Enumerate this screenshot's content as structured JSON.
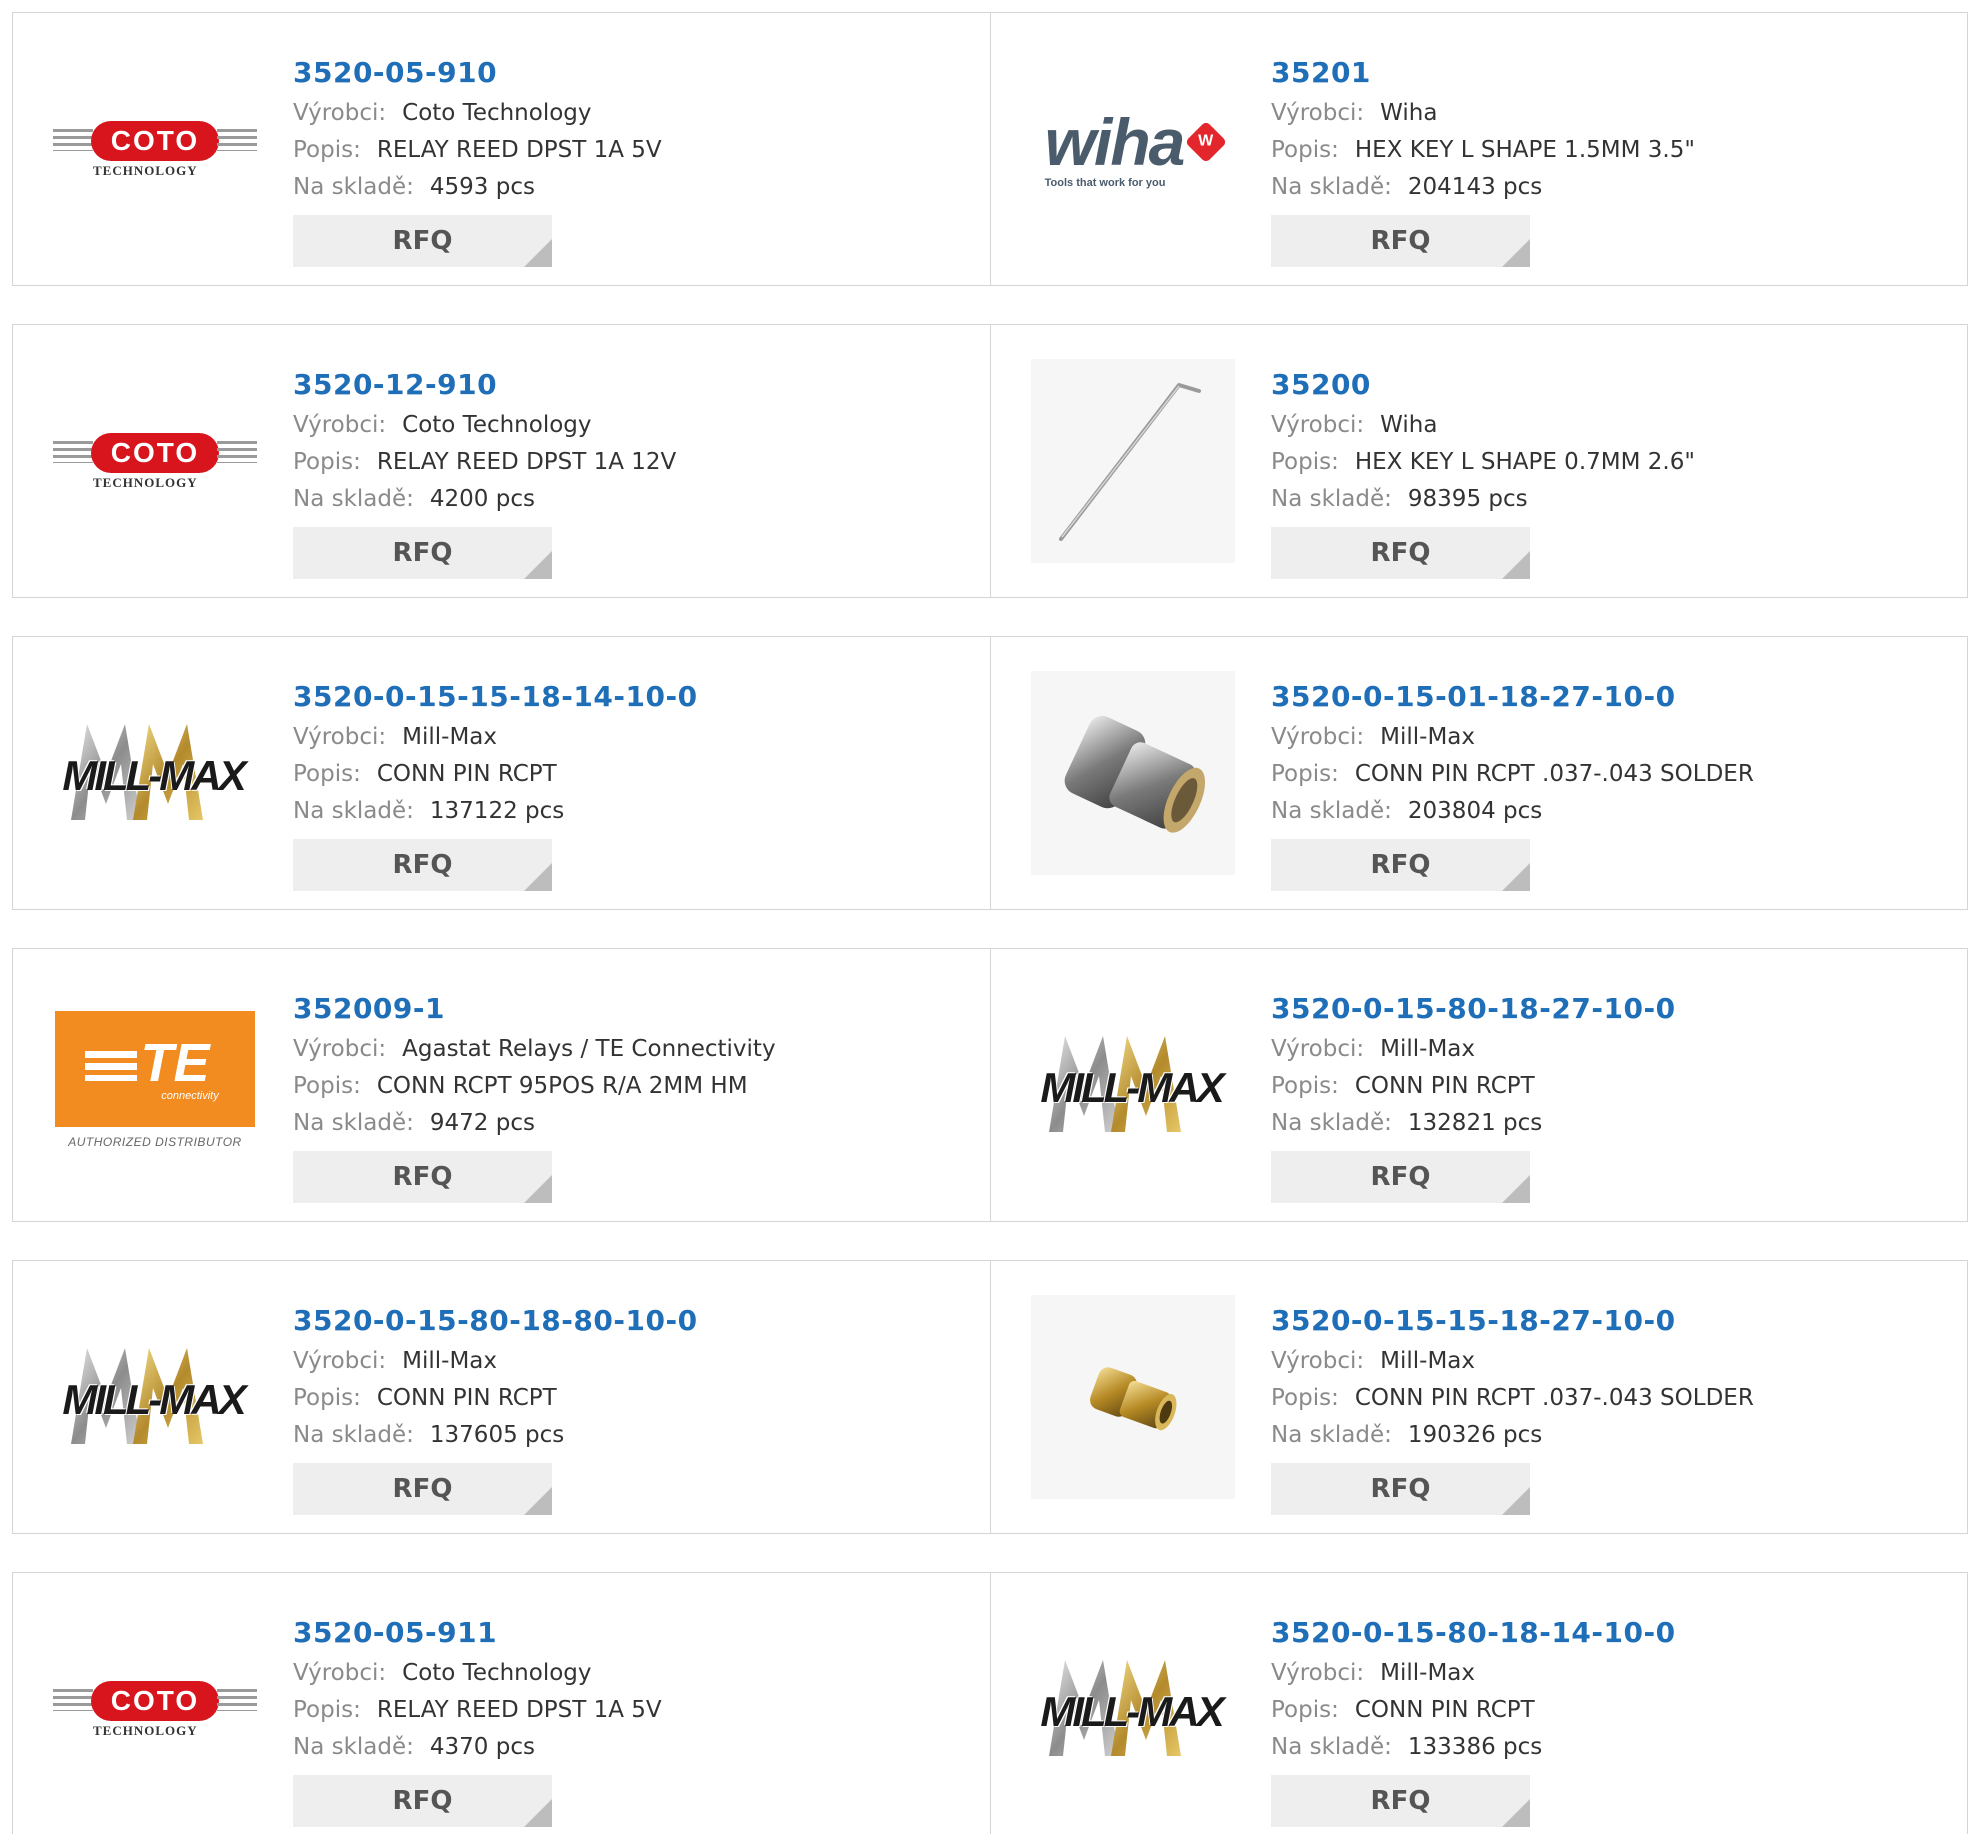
{
  "labels": {
    "manufacturer": "Výrobci:",
    "description": "Popis:",
    "stock": "Na skladě:",
    "rfq": "RFQ"
  },
  "rows": [
    {
      "left": {
        "part": "3520-05-910",
        "manufacturer": "Coto Technology",
        "description": "RELAY REED DPST 1A 5V",
        "stock": "4593 pcs",
        "logo": "coto-logo"
      },
      "right": {
        "part": "35201",
        "manufacturer": "Wiha",
        "description": "HEX KEY L SHAPE 1.5MM 3.5\"",
        "stock": "204143 pcs",
        "logo": "wiha-logo"
      }
    },
    {
      "left": {
        "part": "3520-12-910",
        "manufacturer": "Coto Technology",
        "description": "RELAY REED DPST 1A 12V",
        "stock": "4200 pcs",
        "logo": "coto-logo"
      },
      "right": {
        "part": "35200",
        "manufacturer": "Wiha",
        "description": "HEX KEY L SHAPE 0.7MM 2.6\"",
        "stock": "98395 pcs",
        "logo": "hex-key-photo"
      }
    },
    {
      "left": {
        "part": "3520-0-15-15-18-14-10-0",
        "manufacturer": "Mill-Max",
        "description": "CONN PIN RCPT",
        "stock": "137122 pcs",
        "logo": "millmax-logo"
      },
      "right": {
        "part": "3520-0-15-01-18-27-10-0",
        "manufacturer": "Mill-Max",
        "description": "CONN PIN RCPT .037-.043 SOLDER",
        "stock": "203804 pcs",
        "logo": "silver-pin-photo"
      }
    },
    {
      "left": {
        "part": "352009-1",
        "manufacturer": "Agastat Relays / TE Connectivity",
        "description": "CONN RCPT 95POS R/A 2MM HM",
        "stock": "9472 pcs",
        "logo": "te-logo"
      },
      "right": {
        "part": "3520-0-15-80-18-27-10-0",
        "manufacturer": "Mill-Max",
        "description": "CONN PIN RCPT",
        "stock": "132821 pcs",
        "logo": "millmax-logo"
      }
    },
    {
      "left": {
        "part": "3520-0-15-80-18-80-10-0",
        "manufacturer": "Mill-Max",
        "description": "CONN PIN RCPT",
        "stock": "137605 pcs",
        "logo": "millmax-logo"
      },
      "right": {
        "part": "3520-0-15-15-18-27-10-0",
        "manufacturer": "Mill-Max",
        "description": "CONN PIN RCPT .037-.043 SOLDER",
        "stock": "190326 pcs",
        "logo": "gold-pin-photo"
      }
    },
    {
      "left": {
        "part": "3520-05-911",
        "manufacturer": "Coto Technology",
        "description": "RELAY REED DPST 1A 5V",
        "stock": "4370 pcs",
        "logo": "coto-logo"
      },
      "right": {
        "part": "3520-0-15-80-18-14-10-0",
        "manufacturer": "Mill-Max",
        "description": "CONN PIN RCPT",
        "stock": "133386 pcs",
        "logo": "millmax-logo"
      }
    }
  ],
  "brand_text": {
    "coto_main": "COTO",
    "coto_sub": "TECHNOLOGY",
    "wiha_main": "wiha",
    "wiha_badge": "W",
    "wiha_tag": "Tools that work for you",
    "millmax": "MILL-MAX",
    "te_main": "TE",
    "te_conn": "connectivity",
    "te_auth": "AUTHORIZED DISTRIBUTOR"
  },
  "colors": {
    "link": "#1f6eb8",
    "label": "#8a8a8a",
    "value": "#333333",
    "rfq_bg": "#eeeeee",
    "coto_red": "#d8141c",
    "te_orange": "#f28b20",
    "wiha_red": "#e3262c"
  }
}
